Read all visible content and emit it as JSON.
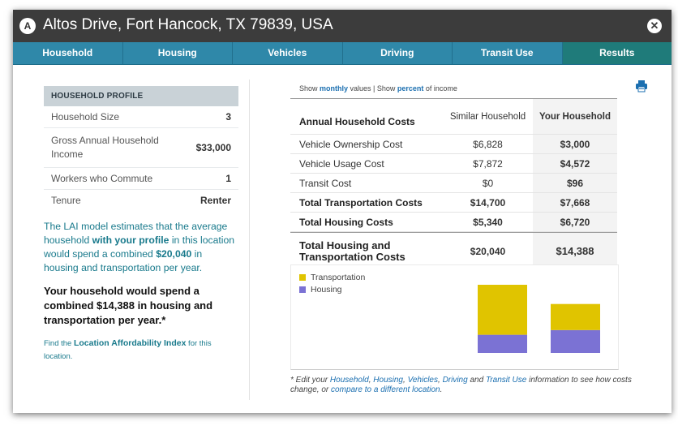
{
  "window": {
    "badge": "A",
    "title": "Altos Drive, Fort Hancock, TX 79839, USA",
    "close_symbol": "✕"
  },
  "tabs": [
    "Household",
    "Housing",
    "Vehicles",
    "Driving",
    "Transit Use",
    "Results"
  ],
  "active_tab": "Results",
  "profile": {
    "heading": "HOUSEHOLD PROFILE",
    "rows": [
      {
        "label": "Household Size",
        "value": "3"
      },
      {
        "label": "Gross Annual Household Income",
        "value": "$33,000"
      },
      {
        "label": "Workers who Commute",
        "value": "1"
      },
      {
        "label": "Tenure",
        "value": "Renter"
      }
    ]
  },
  "lai": {
    "p1": "The LAI model estimates that the average household ",
    "bold1": "with your profile",
    "p2": " in this location would spend a combined ",
    "bold2": "$20,040",
    "p3": " in housing and transportation per year.",
    "spend_pre": "Your household would spend a combined ",
    "spend_amount": "$14,388",
    "spend_post": " in housing and transportation per year.*",
    "find_pre": "Find the ",
    "find_link": "Location Affordability Index",
    "find_post": " for this location."
  },
  "showline": {
    "pre": "Show ",
    "monthly": "monthly",
    "mid": " values | Show ",
    "percent": "percent",
    "post": " of income"
  },
  "table": {
    "header": {
      "label": "Annual Household Costs",
      "similar": "Similar Household",
      "yours": "Your Household"
    },
    "rows": [
      {
        "label": "Vehicle Ownership Cost",
        "similar": "$6,828",
        "yours": "$3,000",
        "bold": false
      },
      {
        "label": "Vehicle Usage Cost",
        "similar": "$7,872",
        "yours": "$4,572",
        "bold": false
      },
      {
        "label": "Transit Cost",
        "similar": "$0",
        "yours": "$96",
        "bold": false
      },
      {
        "label": "Total Transportation Costs",
        "similar": "$14,700",
        "yours": "$7,668",
        "bold": true
      },
      {
        "label": "Total Housing Costs",
        "similar": "$5,340",
        "yours": "$6,720",
        "bold": true
      }
    ],
    "total": {
      "label": "Total Housing and Transportation Costs",
      "similar": "$20,040",
      "yours": "$14,388"
    }
  },
  "chart_data": {
    "type": "bar",
    "stacked": true,
    "categories": [
      "Similar Household",
      "Your Household"
    ],
    "series": [
      {
        "name": "Transportation",
        "values": [
          14700,
          7668
        ],
        "color": "#e0c400"
      },
      {
        "name": "Housing",
        "values": [
          5340,
          6720
        ],
        "color": "#7b72d4"
      }
    ],
    "legend_position": "top-left",
    "grid": false
  },
  "footnote": {
    "t1": "* Edit your ",
    "l1": "Household",
    "t2": ", ",
    "l2": "Housing",
    "t3": ", ",
    "l3": "Vehicles",
    "t4": ", ",
    "l4": "Driving",
    "t5": " and ",
    "l5": "Transit Use",
    "t6": " information to see how costs change, or ",
    "l6": "compare to a different location",
    "t7": "."
  },
  "icons": {
    "print": "print-icon"
  }
}
